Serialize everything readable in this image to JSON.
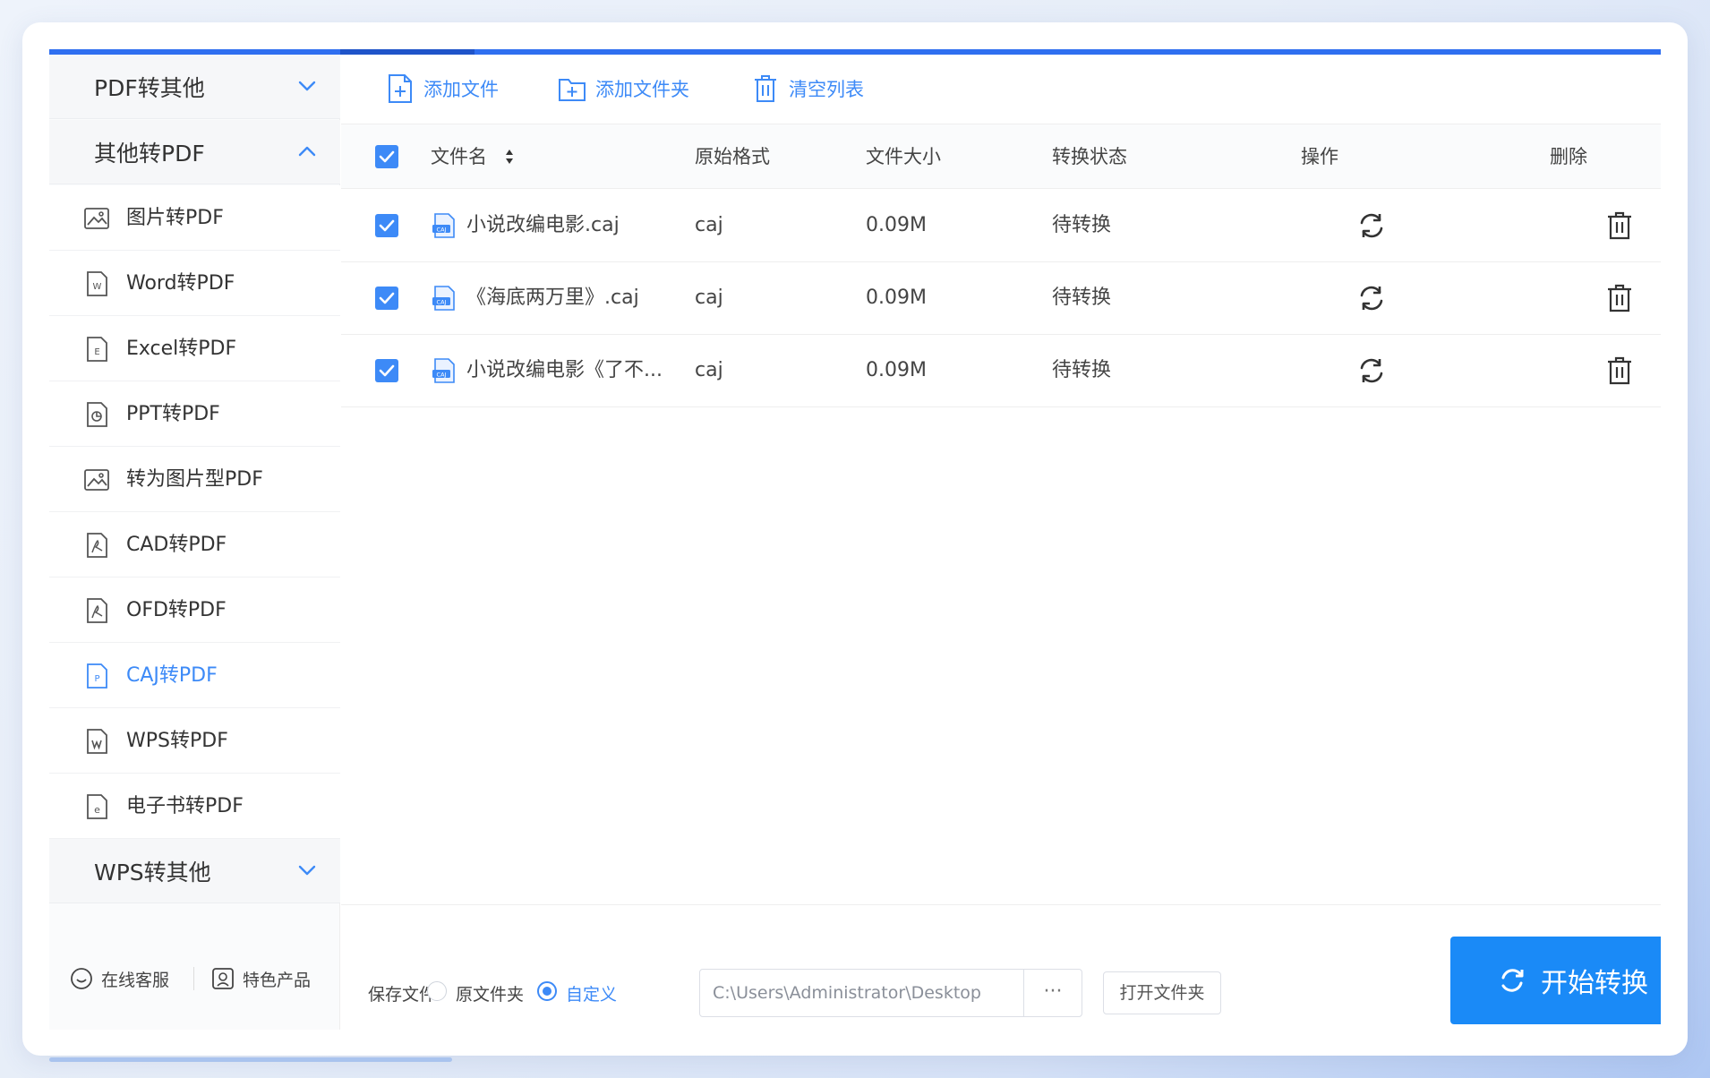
{
  "sidebar": {
    "groups": [
      {
        "label": "PDF转其他",
        "expanded": false
      },
      {
        "label": "其他转PDF",
        "expanded": true
      },
      {
        "label": "WPS转其他",
        "expanded": false
      }
    ],
    "items": [
      {
        "label": "图片转PDF",
        "icon": "image-icon"
      },
      {
        "label": "Word转PDF",
        "icon": "word-icon"
      },
      {
        "label": "Excel转PDF",
        "icon": "excel-icon"
      },
      {
        "label": "PPT转PDF",
        "icon": "ppt-icon"
      },
      {
        "label": "转为图片型PDF",
        "icon": "image-icon"
      },
      {
        "label": "CAD转PDF",
        "icon": "pdf-icon"
      },
      {
        "label": "OFD转PDF",
        "icon": "pdf-icon"
      },
      {
        "label": "CAJ转PDF",
        "icon": "p-icon",
        "active": true
      },
      {
        "label": "WPS转PDF",
        "icon": "wps-icon"
      },
      {
        "label": "电子书转PDF",
        "icon": "ebook-icon"
      }
    ],
    "bottom": {
      "service_label": "在线客服",
      "products_label": "特色产品"
    }
  },
  "toolbar": {
    "add_file": "添加文件",
    "add_folder": "添加文件夹",
    "clear_list": "清空列表"
  },
  "table": {
    "headers": {
      "name": "文件名",
      "format": "原始格式",
      "size": "文件大小",
      "status": "转换状态",
      "action": "操作",
      "delete": "删除"
    },
    "rows": [
      {
        "name": "小说改编电影.caj",
        "format": "caj",
        "size": "0.09M",
        "status": "待转换",
        "checked": true
      },
      {
        "name": "《海底两万里》.caj",
        "format": "caj",
        "size": "0.09M",
        "status": "待转换",
        "checked": true
      },
      {
        "name": "小说改编电影《了不...",
        "format": "caj",
        "size": "0.09M",
        "status": "待转换",
        "checked": true
      }
    ]
  },
  "footer": {
    "save_label": "保存文件:",
    "option_original": "原文件夹",
    "option_custom": "自定义",
    "selected_option": "自定义",
    "path_value": "C:\\Users\\Administrator\\Desktop",
    "browse_label": "···",
    "open_folder": "打开文件夹",
    "start_button": "开始转换"
  },
  "colors": {
    "accent": "#3d8af7",
    "start_button": "#1a8af7",
    "top_bar": "#2f6ff0"
  }
}
